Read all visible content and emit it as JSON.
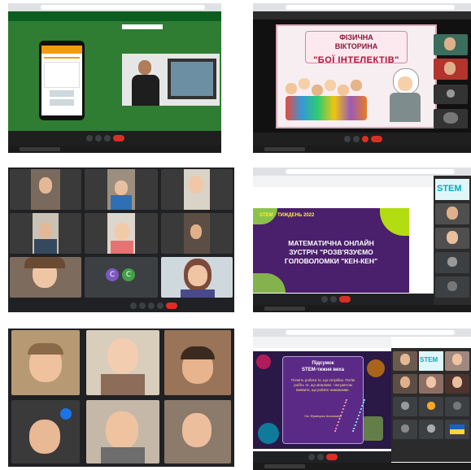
{
  "panel2": {
    "title_line1": "ФІЗИЧНА",
    "title_line2": "ВІКТОРИНА",
    "title_line3": "\"БОЇ ІНТЕЛЕКТІВ\""
  },
  "panel4": {
    "week_label": "STEM - ТИЖДЕНЬ 2022",
    "heading_line1": "МАТЕМАТИЧНА ОНЛАЙН",
    "heading_line2": "ЗУСТРІЧ \"РОЗВ'ЯЗУЄМО",
    "heading_line3": "ГОЛОВОЛОМКИ \"КЕН-КЕН\"",
    "avatar_letters": [
      "C",
      "C"
    ],
    "side_label": "STEM"
  },
  "panel6": {
    "card_title_line1": "Підсумок",
    "card_title_line2": "STEM-тижня веха",
    "card_body": "Почніть робити те, що потрібно. Потім робіть те, що можливо. І ви раптом виявите, що робите неможливе.",
    "card_author": "Св. Франциск Ассизький",
    "side_label": "STEM"
  },
  "colors": {
    "zoom_dark": "#202124",
    "green_meet": "#2e7d32",
    "purple_slide": "#4a1f6b",
    "end_call_red": "#d93025",
    "poster_pink": "#e8b7c8"
  }
}
